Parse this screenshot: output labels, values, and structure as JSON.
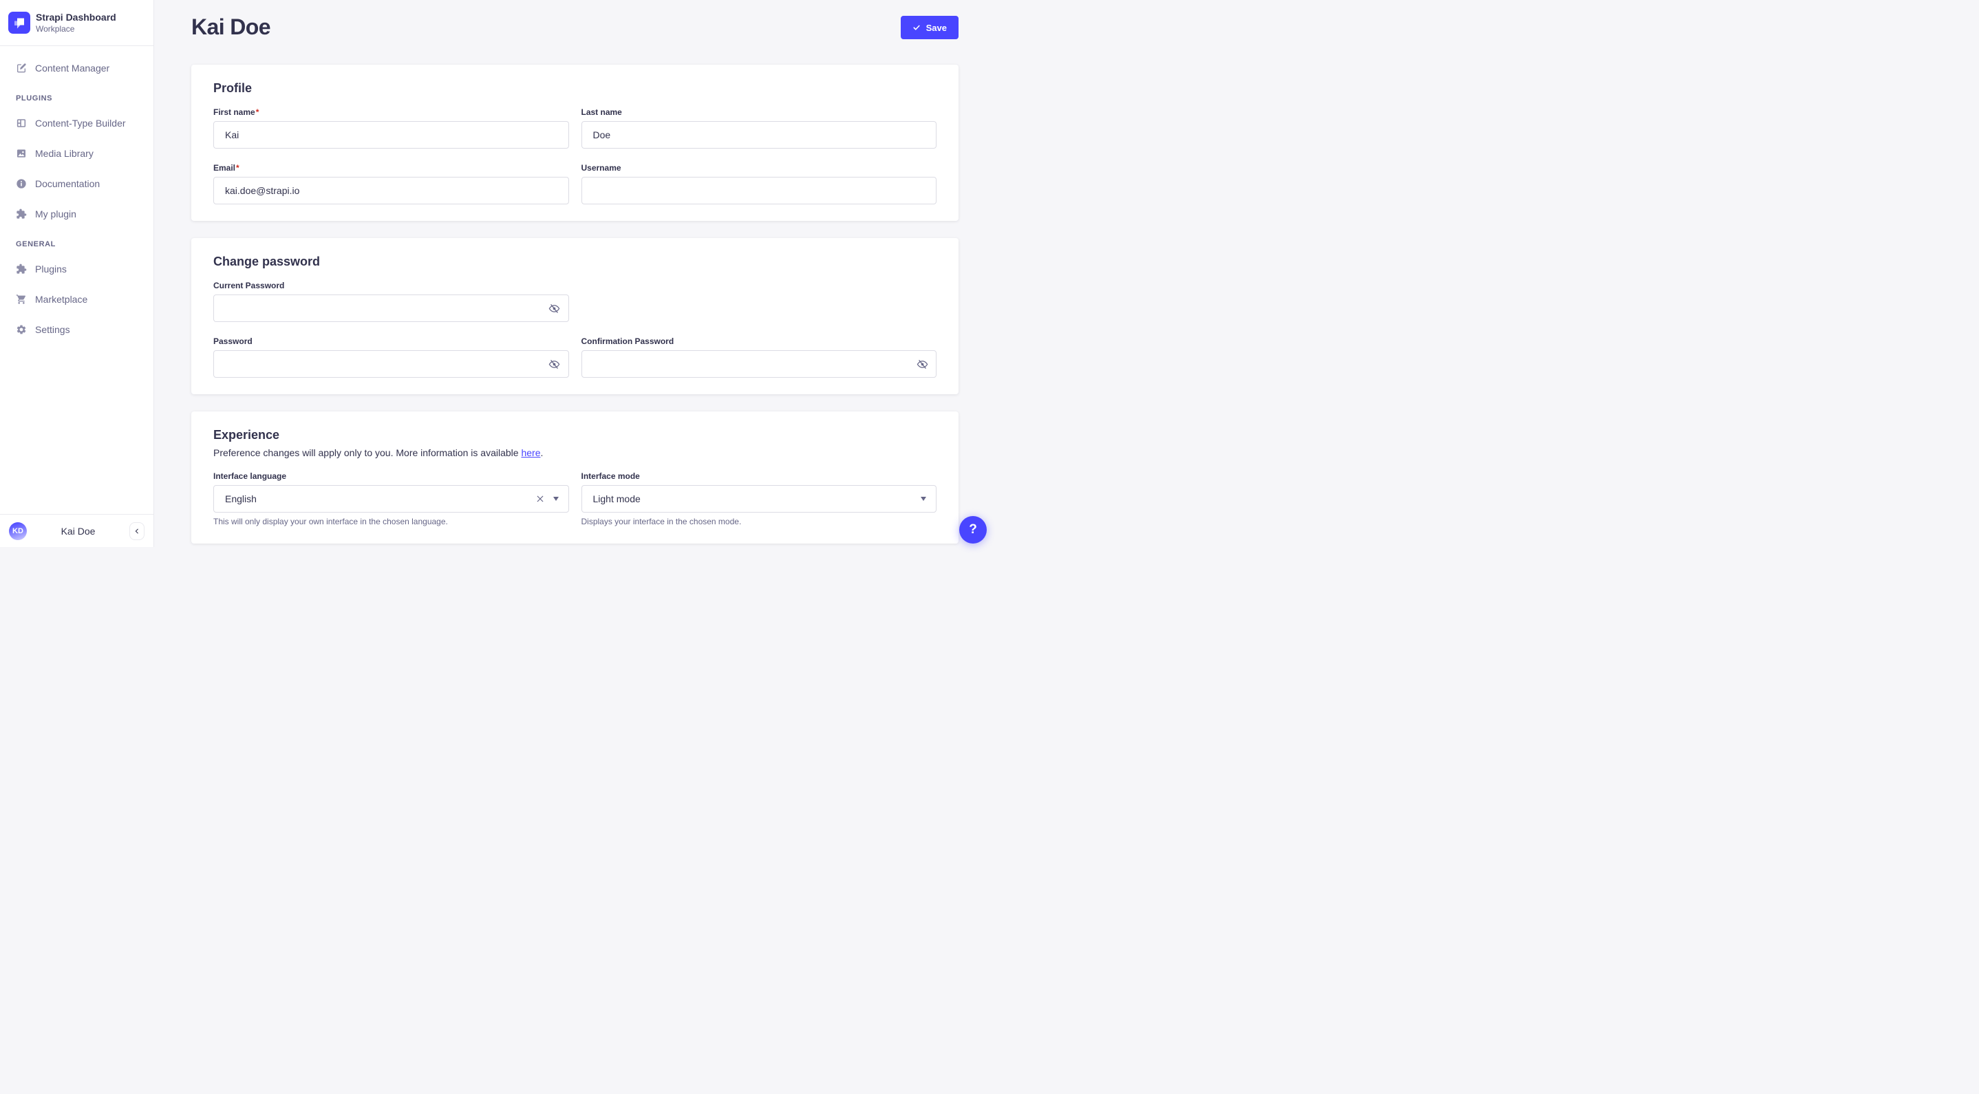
{
  "brand": {
    "title": "Strapi Dashboard",
    "subtitle": "Workplace"
  },
  "sidebar": {
    "primary": [
      {
        "label": "Content Manager",
        "icon": "edit-icon"
      }
    ],
    "sections": [
      {
        "title": "PLUGINS",
        "items": [
          {
            "label": "Content-Type Builder",
            "icon": "layout-icon"
          },
          {
            "label": "Media Library",
            "icon": "image-icon"
          },
          {
            "label": "Documentation",
            "icon": "info-icon"
          },
          {
            "label": "My plugin",
            "icon": "puzzle-icon"
          }
        ]
      },
      {
        "title": "GENERAL",
        "items": [
          {
            "label": "Plugins",
            "icon": "puzzle-icon"
          },
          {
            "label": "Marketplace",
            "icon": "cart-icon"
          },
          {
            "label": "Settings",
            "icon": "gear-icon"
          }
        ]
      }
    ],
    "user": {
      "initials": "KD",
      "name": "Kai Doe"
    }
  },
  "header": {
    "title": "Kai Doe",
    "save_button": {
      "label": "Save",
      "icon": "check-icon"
    }
  },
  "ui": {
    "required_marker": "*"
  },
  "profile_card": {
    "title": "Profile",
    "fields": {
      "first_name": {
        "label": "First name",
        "value": "Kai",
        "required": true
      },
      "last_name": {
        "label": "Last name",
        "value": "Doe"
      },
      "email": {
        "label": "Email",
        "value": "kai.doe@strapi.io",
        "required": true
      },
      "username": {
        "label": "Username",
        "value": ""
      }
    }
  },
  "password_card": {
    "title": "Change password",
    "fields": {
      "current": {
        "label": "Current Password",
        "value": ""
      },
      "new": {
        "label": "Password",
        "value": ""
      },
      "confirm": {
        "label": "Confirmation Password",
        "value": ""
      }
    }
  },
  "experience_card": {
    "title": "Experience",
    "description": {
      "text": "Preference changes will apply only to you. More information is available ",
      "link": "here",
      "suffix": "."
    },
    "fields": {
      "language": {
        "label": "Interface language",
        "value": "English",
        "hint": "This will only display your own interface in the chosen language."
      },
      "mode": {
        "label": "Interface mode",
        "value": "Light mode",
        "hint": "Displays your interface in the chosen mode."
      }
    }
  },
  "help_button": {
    "label": "?"
  },
  "colors": {
    "primary": "#4945ff",
    "text": "#32324d",
    "muted": "#666687",
    "input_border": "#dcdce4",
    "divider": "#eaeaef",
    "background": "#f6f6f9",
    "surface": "#ffffff",
    "danger": "#d02b20"
  }
}
